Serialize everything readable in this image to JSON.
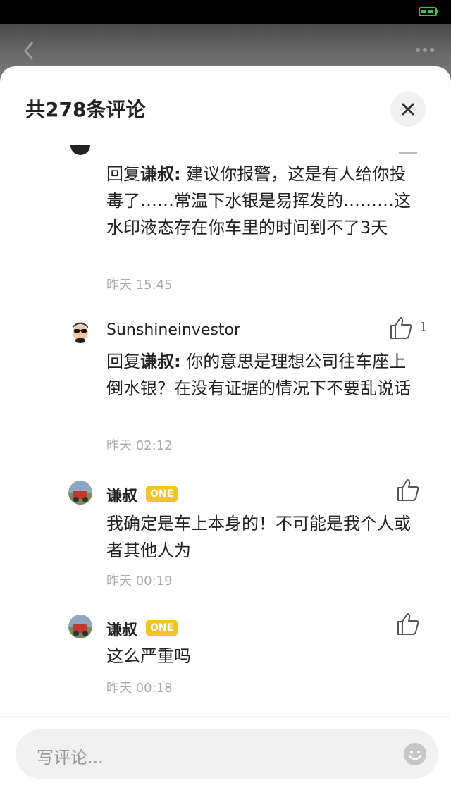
{
  "sheet": {
    "title": "共278条评论"
  },
  "comments": [
    {
      "reply_prefix": "回复",
      "reply_to": "谦叔:",
      "body": " 建议你报警，这是有人给你投毒了……常温下水银是易挥发的………这水印液态存在你车里的时间到不了3天",
      "time": "昨天 15:45"
    },
    {
      "author": "Sunshineinvestor",
      "reply_prefix": "回复",
      "reply_to": "谦叔:",
      "body": " 你的意思是理想公司往车座上倒水银？在没有证据的情况下不要乱说话",
      "time": "昨天 02:12",
      "likes": "1"
    },
    {
      "author": "谦叔",
      "badge": "ONE",
      "body": "我确定是车上本身的！不可能是我个人或者其他人为",
      "time": "昨天 00:19"
    },
    {
      "author": "谦叔",
      "badge": "ONE",
      "body": "这么严重吗",
      "time": "昨天 00:18"
    }
  ],
  "input": {
    "placeholder": "写评论..."
  },
  "colors": {
    "badge": "#f7c324",
    "battery": "#2ecc40"
  }
}
